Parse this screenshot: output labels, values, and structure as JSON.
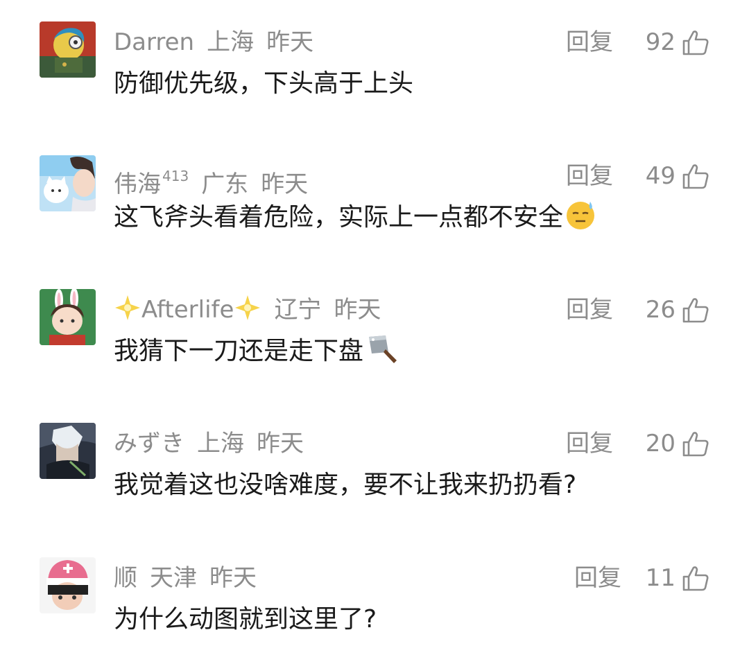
{
  "ui": {
    "reply_label": "回复",
    "colors": {
      "meta_gray": "#8c8c8c",
      "text_dark": "#1a1a1a"
    }
  },
  "comments": [
    {
      "username": "Darren",
      "location": "上海",
      "time": "昨天",
      "text": "防御优先级，下头高于上头",
      "likes": "92",
      "avatar": "avatar-cartoon-character-red-green"
    },
    {
      "username": "伟海",
      "level": "413",
      "location": "广东",
      "time": "昨天",
      "text": "这飞斧头看着危险，实际上一点都不安全",
      "emoji": "sweat-smile-emoji",
      "likes": "49",
      "avatar": "avatar-anime-boy-white-cat"
    },
    {
      "username": "Afterlife",
      "location": "辽宁",
      "time": "昨天",
      "text": "我猜下一刀还是走下盘",
      "emoji": "cleaver-emoji",
      "likes": "26",
      "avatar": "avatar-bunny-ear-cartoon"
    },
    {
      "username": "みずき",
      "location": "上海",
      "time": "昨天",
      "text": "我觉着这也没啥难度，要不让我来扔扔看?",
      "likes": "20",
      "avatar": "avatar-anime-white-hair-dark"
    },
    {
      "username": "顺",
      "location": "天津",
      "time": "昨天",
      "text": "为什么动图就到这里了?",
      "likes": "11",
      "avatar": "avatar-chopper-pink-hat"
    }
  ]
}
